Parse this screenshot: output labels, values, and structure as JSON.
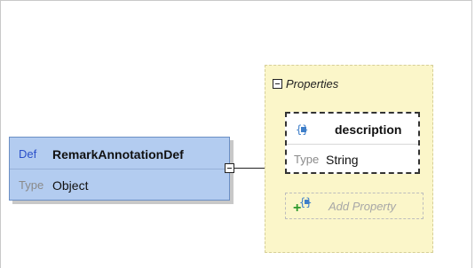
{
  "def_node": {
    "keyword": "Def",
    "name": "RemarkAnnotationDef",
    "type_keyword": "Type",
    "type_value": "Object"
  },
  "properties_panel": {
    "title": "Properties",
    "items": [
      {
        "icon": "element-icon",
        "name": "description",
        "type_keyword": "Type",
        "type_value": "String"
      }
    ],
    "add_label": "Add Property"
  },
  "colors": {
    "def_background": "#b3ccf0",
    "def_keyword": "#2a4fc9",
    "panel_background": "#fbf6c9",
    "add_plus": "#2e9a2e",
    "element_icon": "#3f7fc9"
  }
}
